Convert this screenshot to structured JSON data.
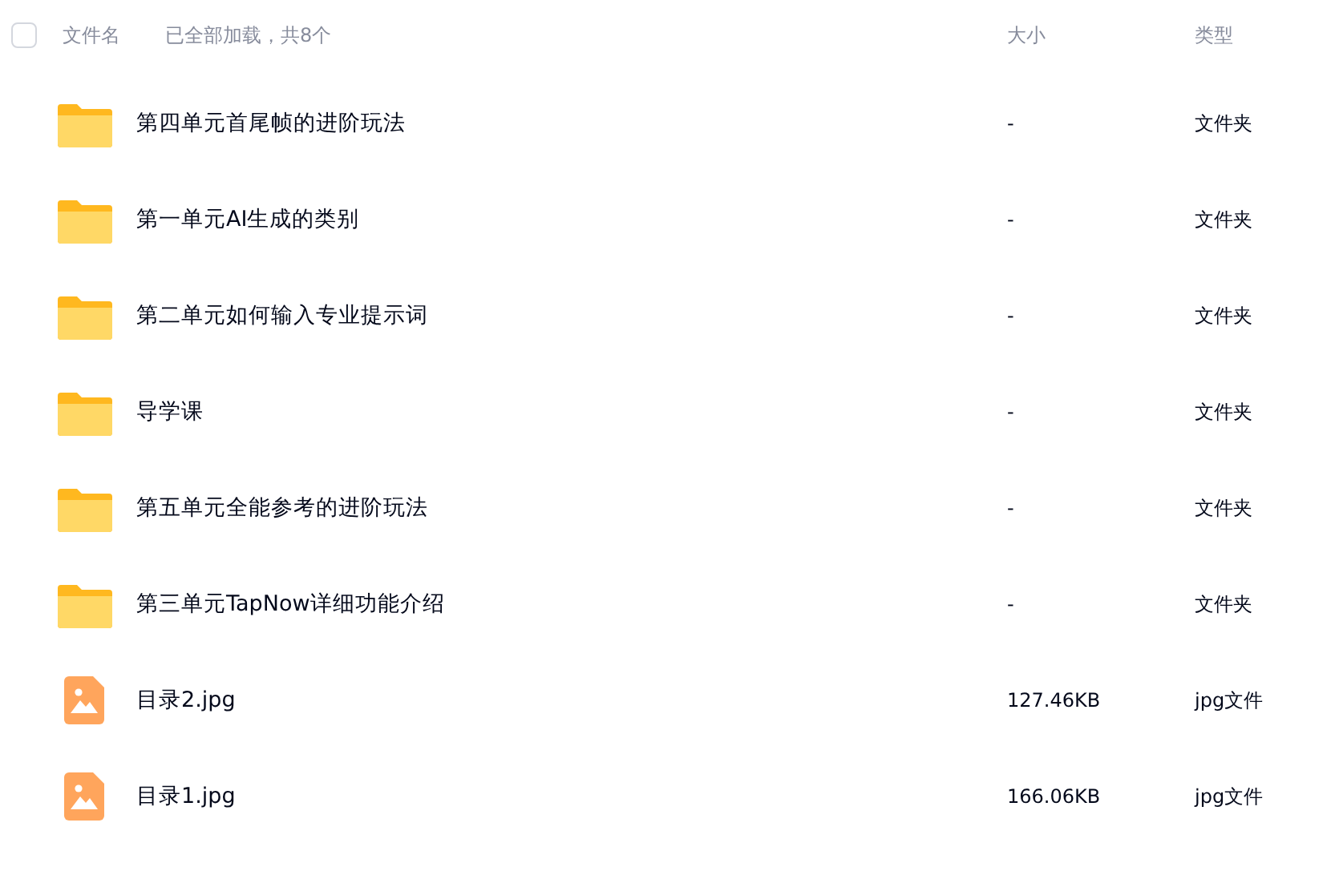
{
  "header": {
    "checked": false,
    "name_label": "文件名",
    "load_status": "已全部加载，共8个",
    "size_label": "大小",
    "type_label": "类型"
  },
  "files": [
    {
      "kind": "folder",
      "name": "第四单元首尾帧的进阶玩法",
      "size": "-",
      "type": "文件夹"
    },
    {
      "kind": "folder",
      "name": "第一单元AI生成的类别",
      "size": "-",
      "type": "文件夹"
    },
    {
      "kind": "folder",
      "name": "第二单元如何输入专业提示词",
      "size": "-",
      "type": "文件夹"
    },
    {
      "kind": "folder",
      "name": "导学课",
      "size": "-",
      "type": "文件夹"
    },
    {
      "kind": "folder",
      "name": "第五单元全能参考的进阶玩法",
      "size": "-",
      "type": "文件夹"
    },
    {
      "kind": "folder",
      "name": "第三单元TapNow详细功能介绍",
      "size": "-",
      "type": "文件夹"
    },
    {
      "kind": "image",
      "name": "目录2.jpg",
      "size": "127.46KB",
      "type": "jpg文件"
    },
    {
      "kind": "image",
      "name": "目录1.jpg",
      "size": "166.06KB",
      "type": "jpg文件"
    }
  ]
}
